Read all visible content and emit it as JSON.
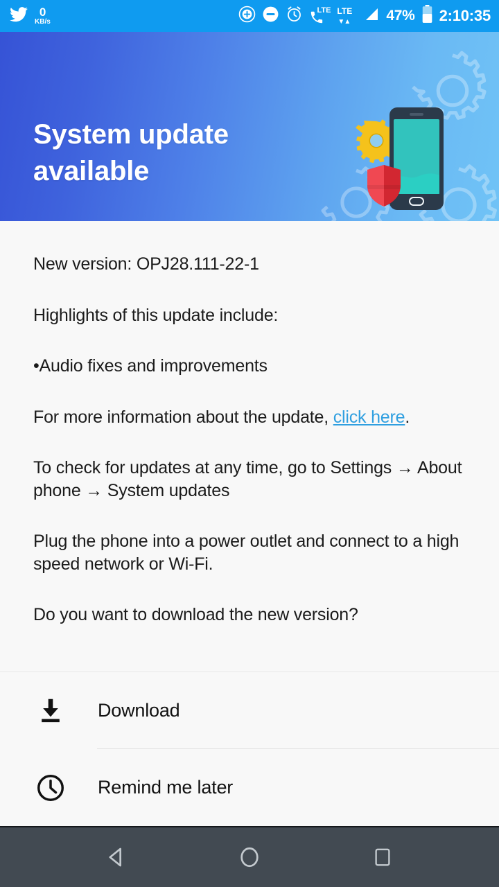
{
  "statusbar": {
    "app_icon": "twitter-bird-icon",
    "network_speed_value": "0",
    "network_speed_unit": "KB/s",
    "icons": [
      "add-circle-icon",
      "do-not-disturb-icon",
      "alarm-clock-icon",
      "volte-call-icon",
      "lte-data-icon",
      "signal-bars-icon"
    ],
    "lte_call_label": "LTE",
    "lte_data_label": "LTE",
    "battery_percent": "47%",
    "battery_icon": "battery-icon",
    "time": "2:10:35",
    "background_color": "#0f9bf0"
  },
  "banner": {
    "title_line1": "System update",
    "title_line2": "available",
    "gradient_start": "#3653d6",
    "gradient_end": "#70c3f6",
    "illustration": {
      "phone_body_color": "#2b3a4a",
      "phone_screen_color": "#32c3bd",
      "gear_color": "#f5c21b",
      "shield_color": "#e0242e"
    }
  },
  "body": {
    "version_line": "New version: OPJ28.111-22-1",
    "highlights_heading": "Highlights of this update include:",
    "highlight_bullet": "•Audio fixes and improvements",
    "more_info_prefix": "For more information about the update, ",
    "more_info_link": "click here",
    "more_info_suffix": ".",
    "check_updates_text": "To check for updates at any time, go to Settings → About phone → System updates",
    "plug_in_text": "Plug the phone into a power outlet and connect to a high speed network or Wi-Fi.",
    "question_text": "Do you want to download the new version?",
    "link_color": "#2f9fe0"
  },
  "actions": [
    {
      "label": "Download",
      "icon": "download-icon"
    },
    {
      "label": "Remind me later",
      "icon": "clock-icon"
    }
  ],
  "navbar": {
    "back": "back-triangle-icon",
    "home": "home-circle-icon",
    "recents": "recents-square-icon",
    "background_color": "#424a52"
  }
}
